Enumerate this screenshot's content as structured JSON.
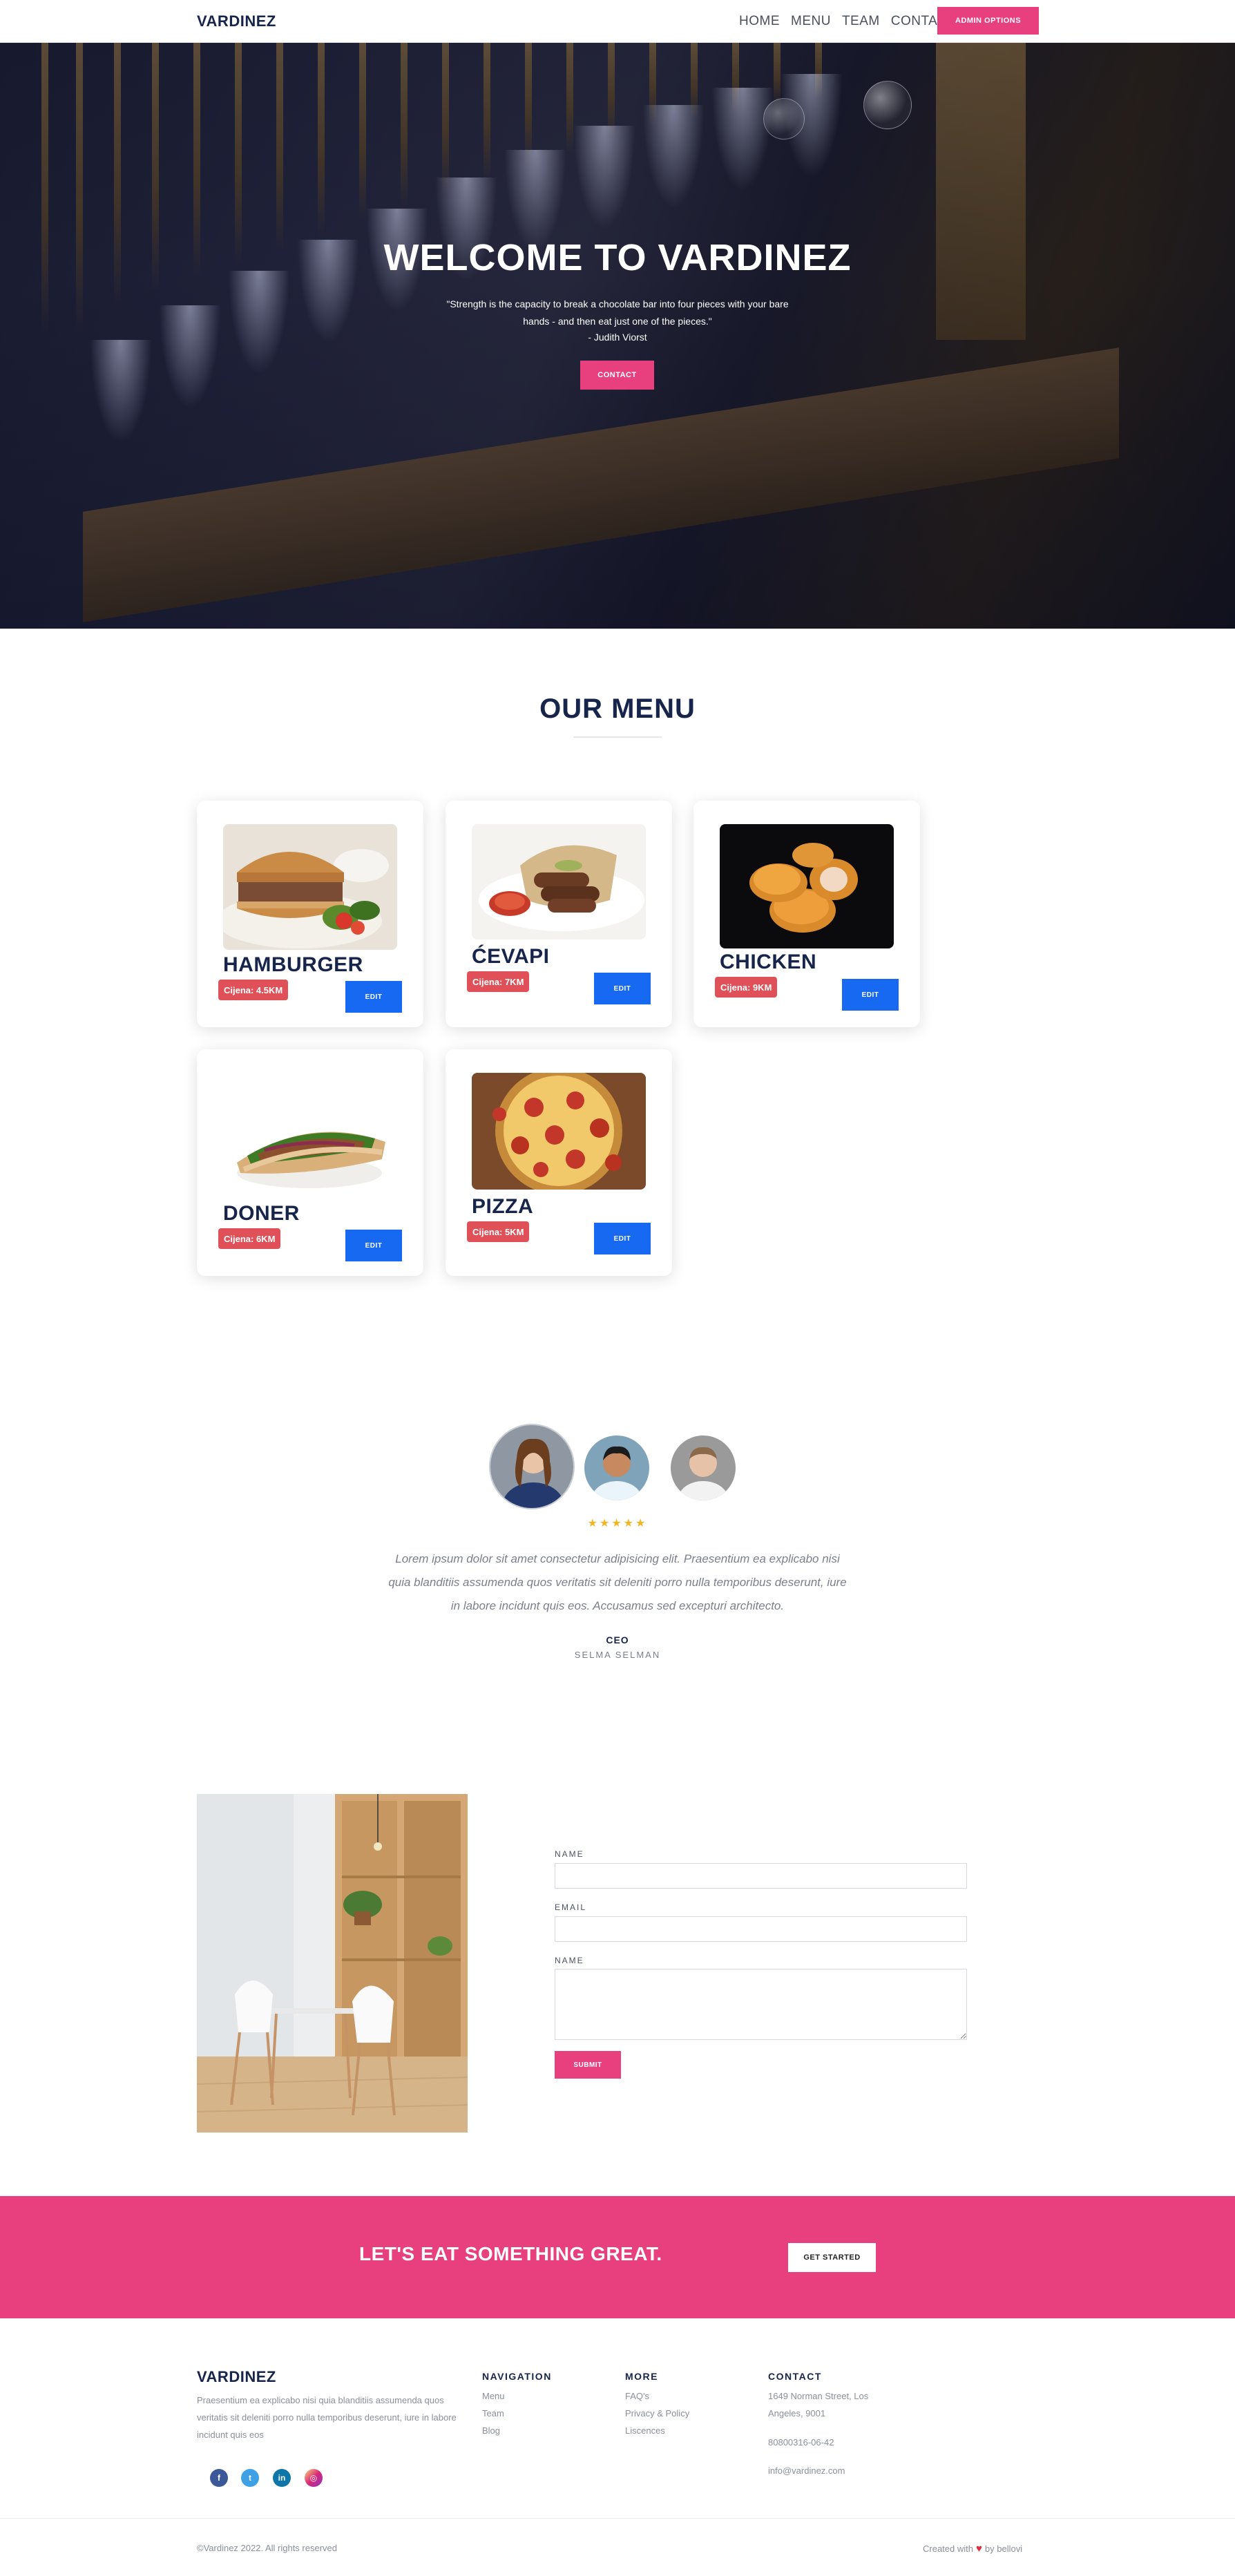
{
  "nav": {
    "brand": "VARDINEZ",
    "items": [
      "HOME",
      "MENU",
      "TEAM",
      "CONTACT"
    ],
    "admin_button": "ADMIN OPTIONS"
  },
  "hero": {
    "title": "WELCOME TO VARDINEZ",
    "quote": "\"Strength is the capacity to break a chocolate bar into four pieces with your bare hands - and then eat just one of the pieces.\"",
    "author": "- Judith Viorst",
    "button": "CONTACT"
  },
  "menu": {
    "title": "OUR MENU",
    "items": [
      {
        "name": "HAMBURGER",
        "price": "Cijena: 4.5KM",
        "edit": "EDIT"
      },
      {
        "name": "ĆEVAPI",
        "price": "Cijena: 7KM",
        "edit": "EDIT"
      },
      {
        "name": "CHICKEN",
        "price": "Cijena: 9KM",
        "edit": "EDIT"
      },
      {
        "name": "DONER",
        "price": "Cijena: 6KM",
        "edit": "EDIT"
      },
      {
        "name": "PIZZA",
        "price": "Cijena: 5KM",
        "edit": "EDIT"
      }
    ]
  },
  "testimonial": {
    "stars": "★★★★★",
    "rating": 5,
    "text": "Lorem ipsum dolor sit amet consectetur adipisicing elit. Praesentium ea explicabo nisi quia blanditiis assumenda quos veritatis sit deleniti porro nulla temporibus deserunt, iure in labore incidunt quis eos. Accusamus sed excepturi architecto.",
    "role": "CEO",
    "name": "SELMA SELMAN"
  },
  "contact_form": {
    "name_label": "NAME",
    "email_label": "EMAIL",
    "message_label": "NAME",
    "name_value": "",
    "email_value": "",
    "message_value": "",
    "submit": "SUBMIT"
  },
  "cta": {
    "text": "LET'S EAT SOMETHING GREAT.",
    "button": "GET STARTED"
  },
  "footer": {
    "brand": "VARDINEZ",
    "description": "Praesentium ea explicabo nisi quia blanditiis assumenda quos veritatis sit deleniti porro nulla temporibus deserunt, iure in labore incidunt quis eos",
    "navigation": {
      "title": "NAVIGATION",
      "links": [
        "Menu",
        "Team",
        "Blog"
      ]
    },
    "more": {
      "title": "MORE",
      "links": [
        "FAQ's",
        "Privacy & Policy",
        "Liscences"
      ]
    },
    "contact": {
      "title": "CONTACT",
      "address_line1": "1649 Norman Street, Los",
      "address_line2": "Angeles, 9001",
      "phone": "80800316-06-42",
      "email": "info@vardinez.com"
    },
    "social": [
      "facebook-icon",
      "twitter-icon",
      "linkedin-icon",
      "instagram-icon"
    ],
    "copyright": "©Vardinez 2022. All rights reserved",
    "credit_prefix": "Created with",
    "credit_suffix": "by bellovi"
  },
  "colors": {
    "accent": "#e8407f",
    "navy": "#17244b",
    "edit_blue": "#1669f0",
    "price_red": "#e05058",
    "star": "#f2b523"
  }
}
